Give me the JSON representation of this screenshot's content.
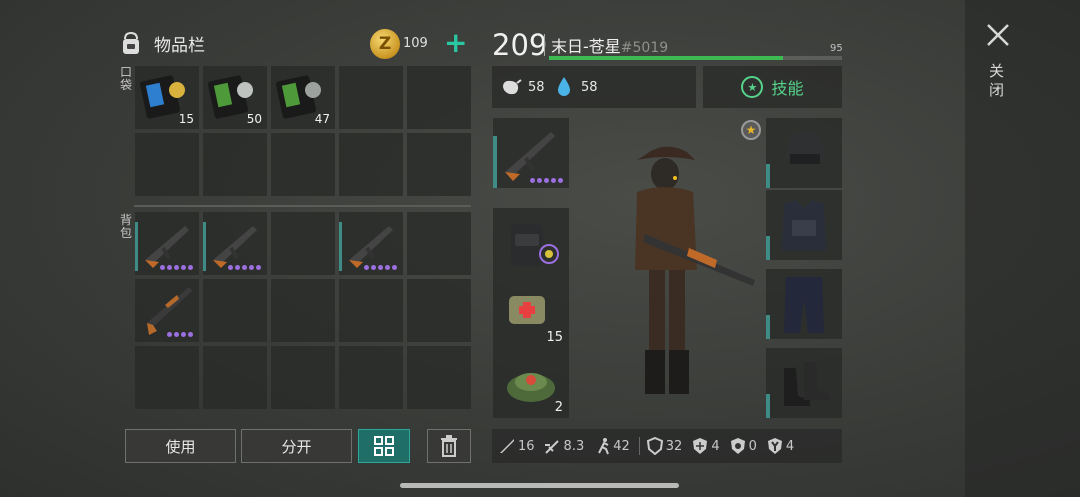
{
  "inventory": {
    "title": "物品栏",
    "coins": "109",
    "pocket_label": "口袋",
    "backpack_label": "背包",
    "pocket_counts": [
      "15",
      "50",
      "47"
    ]
  },
  "actions": {
    "use": "使用",
    "split": "分开"
  },
  "player": {
    "level": "209",
    "name": "末日-苍星",
    "id": "#5019",
    "xp_value": "95",
    "xp_fraction": 0.8,
    "hunger": "58",
    "thirst": "58",
    "skill_label": "技能"
  },
  "equipment": {
    "medkit_count": "15",
    "trap_count": "2"
  },
  "combat_stats": {
    "melee": "16",
    "ranged": "8.3",
    "speed": "42",
    "armor": "32",
    "cold": "4",
    "poison": "0",
    "radiation": "4"
  },
  "close_label": "关闭",
  "colors": {
    "accent": "#2ac7a3",
    "xp": "#3dbb52",
    "rarity": "#9b6fe0",
    "skill": "#55d38a"
  }
}
